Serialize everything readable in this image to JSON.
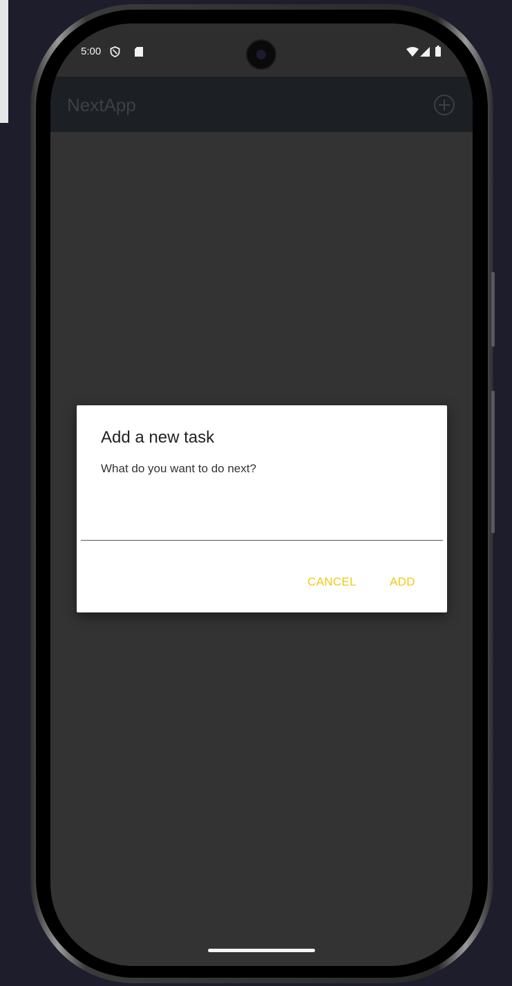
{
  "status_bar": {
    "time": "5:00",
    "icons": [
      "shield-icon",
      "sd-card-icon",
      "wifi-icon",
      "signal-icon",
      "battery-icon"
    ]
  },
  "app_bar": {
    "title": "NextApp",
    "action_icon": "add-circle-icon"
  },
  "dialog": {
    "title": "Add a new task",
    "message": "What do you want to do next?",
    "input_value": "",
    "cancel_label": "CANCEL",
    "add_label": "ADD"
  },
  "colors": {
    "accent": "#f2c811",
    "screen_background": "#333333",
    "app_bar_background": "#1c1f23",
    "dialog_background": "#ffffff"
  }
}
